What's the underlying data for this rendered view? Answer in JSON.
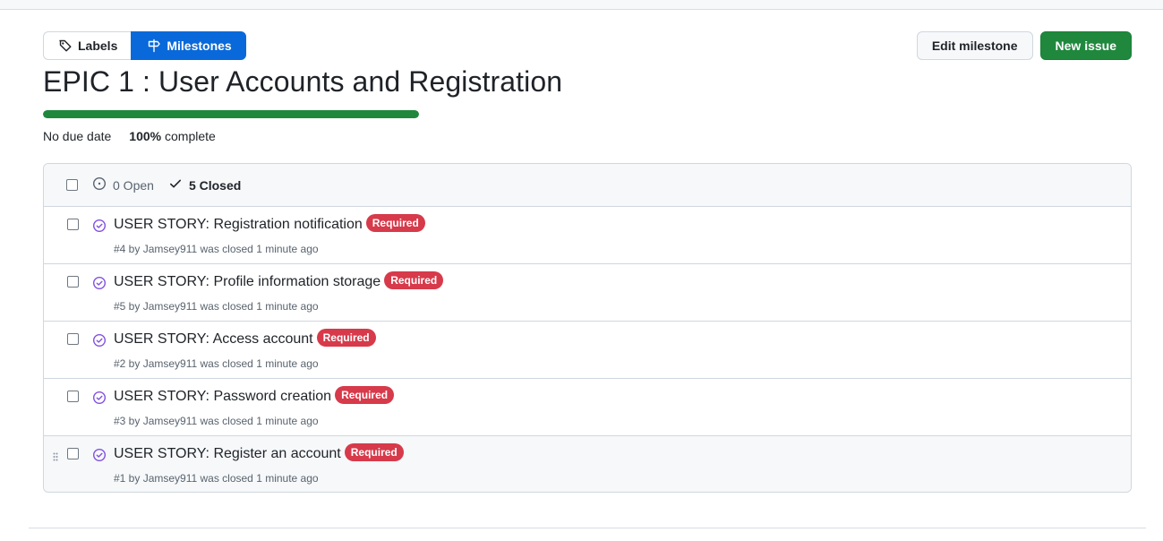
{
  "subnav": {
    "labels": "Labels",
    "milestones": "Milestones"
  },
  "actions": {
    "edit_milestone": "Edit milestone",
    "new_issue": "New issue"
  },
  "milestone": {
    "title": "EPIC 1 : User Accounts and Registration",
    "progress_fraction": 1.0,
    "due": "No due date",
    "percent": "100%",
    "percent_suffix": " complete"
  },
  "list": {
    "open_label": "0 Open",
    "closed_label": "5 Closed",
    "label_color": "#d73a4a",
    "issues": [
      {
        "title": "USER STORY: Registration notification",
        "label": "Required",
        "meta": "#4 by Jamsey911 was closed 1 minute ago"
      },
      {
        "title": "USER STORY: Profile information storage",
        "label": "Required",
        "meta": "#5 by Jamsey911 was closed 1 minute ago"
      },
      {
        "title": "USER STORY: Access account",
        "label": "Required",
        "meta": "#2 by Jamsey911 was closed 1 minute ago"
      },
      {
        "title": "USER STORY: Password creation",
        "label": "Required",
        "meta": "#3 by Jamsey911 was closed 1 minute ago"
      },
      {
        "title": "USER STORY: Register an account",
        "label": "Required",
        "meta": "#1 by Jamsey911 was closed 1 minute ago"
      }
    ]
  },
  "colors": {
    "accent": "#0969da",
    "success": "#1f883d",
    "closed_icon": "#8250df"
  },
  "icons": {
    "labels": "tag-icon",
    "milestones": "milestone-icon",
    "open": "issue-opened-icon",
    "closed": "check-icon",
    "issue_closed": "issue-closed-icon",
    "drag": "grabber-icon"
  }
}
